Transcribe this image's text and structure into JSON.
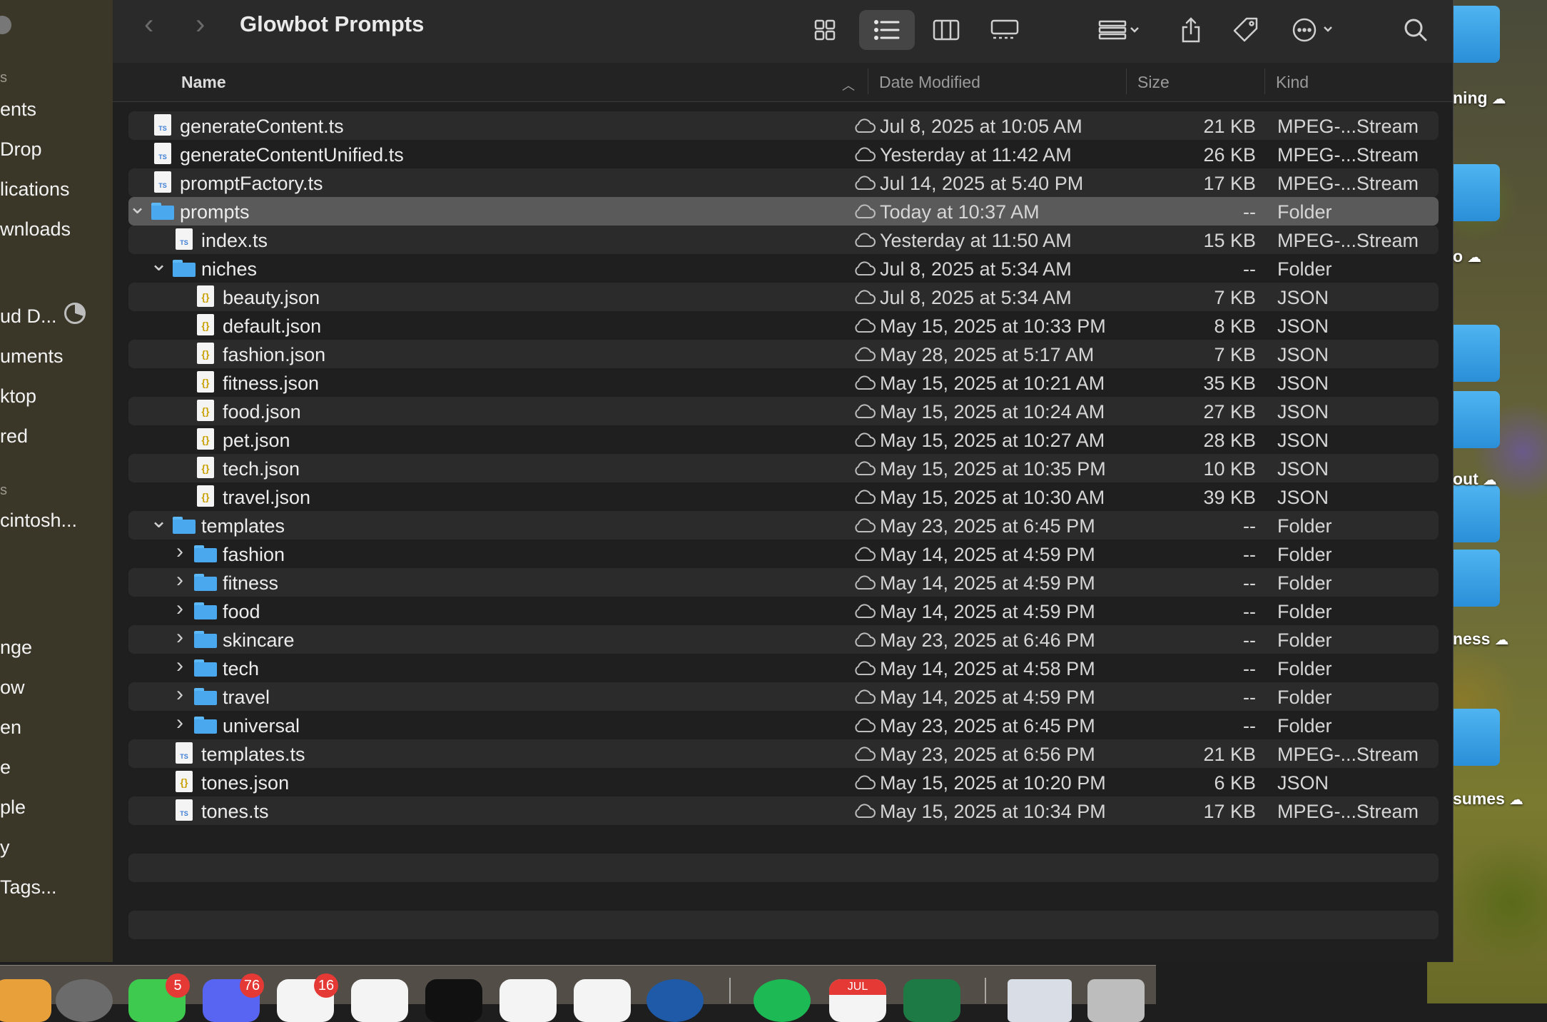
{
  "window": {
    "title": "Glowbot Prompts"
  },
  "columns": {
    "name": "Name",
    "date_modified": "Date Modified",
    "size": "Size",
    "kind": "Kind"
  },
  "sidebar": {
    "items": [
      "ents",
      "Drop",
      "lications",
      "wnloads",
      "ud D...",
      "uments",
      "ktop",
      "red",
      "cintosh...",
      "nge",
      "ow",
      "en",
      "e",
      "ple",
      "y",
      "Tags..."
    ],
    "headers": [
      "s",
      "s"
    ]
  },
  "rows": [
    {
      "name": "generateContent.ts",
      "date": "Jul 8, 2025 at 10:05 AM",
      "size": "21 KB",
      "kind": "MPEG-...Stream",
      "type": "ts",
      "depth": 0,
      "disclosure": ""
    },
    {
      "name": "generateContentUnified.ts",
      "date": "Yesterday at 11:42 AM",
      "size": "26 KB",
      "kind": "MPEG-...Stream",
      "type": "ts",
      "depth": 0,
      "disclosure": ""
    },
    {
      "name": "promptFactory.ts",
      "date": "Jul 14, 2025 at 5:40 PM",
      "size": "17 KB",
      "kind": "MPEG-...Stream",
      "type": "ts",
      "depth": 0,
      "disclosure": ""
    },
    {
      "name": "prompts",
      "date": "Today at 10:37 AM",
      "size": "--",
      "kind": "Folder",
      "type": "folder",
      "depth": 0,
      "disclosure": "open",
      "selected": true
    },
    {
      "name": "index.ts",
      "date": "Yesterday at 11:50 AM",
      "size": "15 KB",
      "kind": "MPEG-...Stream",
      "type": "ts",
      "depth": 1,
      "disclosure": ""
    },
    {
      "name": "niches",
      "date": "Jul 8, 2025 at 5:34 AM",
      "size": "--",
      "kind": "Folder",
      "type": "folder",
      "depth": 1,
      "disclosure": "open"
    },
    {
      "name": "beauty.json",
      "date": "Jul 8, 2025 at 5:34 AM",
      "size": "7 KB",
      "kind": "JSON",
      "type": "json",
      "depth": 2,
      "disclosure": ""
    },
    {
      "name": "default.json",
      "date": "May 15, 2025 at 10:33 PM",
      "size": "8 KB",
      "kind": "JSON",
      "type": "json",
      "depth": 2,
      "disclosure": ""
    },
    {
      "name": "fashion.json",
      "date": "May 28, 2025 at 5:17 AM",
      "size": "7 KB",
      "kind": "JSON",
      "type": "json",
      "depth": 2,
      "disclosure": ""
    },
    {
      "name": "fitness.json",
      "date": "May 15, 2025 at 10:21 AM",
      "size": "35 KB",
      "kind": "JSON",
      "type": "json",
      "depth": 2,
      "disclosure": ""
    },
    {
      "name": "food.json",
      "date": "May 15, 2025 at 10:24 AM",
      "size": "27 KB",
      "kind": "JSON",
      "type": "json",
      "depth": 2,
      "disclosure": ""
    },
    {
      "name": "pet.json",
      "date": "May 15, 2025 at 10:27 AM",
      "size": "28 KB",
      "kind": "JSON",
      "type": "json",
      "depth": 2,
      "disclosure": ""
    },
    {
      "name": "tech.json",
      "date": "May 15, 2025 at 10:35 PM",
      "size": "10 KB",
      "kind": "JSON",
      "type": "json",
      "depth": 2,
      "disclosure": ""
    },
    {
      "name": "travel.json",
      "date": "May 15, 2025 at 10:30 AM",
      "size": "39 KB",
      "kind": "JSON",
      "type": "json",
      "depth": 2,
      "disclosure": ""
    },
    {
      "name": "templates",
      "date": "May 23, 2025 at 6:45 PM",
      "size": "--",
      "kind": "Folder",
      "type": "folder",
      "depth": 1,
      "disclosure": "open"
    },
    {
      "name": "fashion",
      "date": "May 14, 2025 at 4:59 PM",
      "size": "--",
      "kind": "Folder",
      "type": "folder",
      "depth": 2,
      "disclosure": "closed"
    },
    {
      "name": "fitness",
      "date": "May 14, 2025 at 4:59 PM",
      "size": "--",
      "kind": "Folder",
      "type": "folder",
      "depth": 2,
      "disclosure": "closed"
    },
    {
      "name": "food",
      "date": "May 14, 2025 at 4:59 PM",
      "size": "--",
      "kind": "Folder",
      "type": "folder",
      "depth": 2,
      "disclosure": "closed"
    },
    {
      "name": "skincare",
      "date": "May 23, 2025 at 6:46 PM",
      "size": "--",
      "kind": "Folder",
      "type": "folder",
      "depth": 2,
      "disclosure": "closed"
    },
    {
      "name": "tech",
      "date": "May 14, 2025 at 4:58 PM",
      "size": "--",
      "kind": "Folder",
      "type": "folder",
      "depth": 2,
      "disclosure": "closed"
    },
    {
      "name": "travel",
      "date": "May 14, 2025 at 4:59 PM",
      "size": "--",
      "kind": "Folder",
      "type": "folder",
      "depth": 2,
      "disclosure": "closed"
    },
    {
      "name": "universal",
      "date": "May 23, 2025 at 6:45 PM",
      "size": "--",
      "kind": "Folder",
      "type": "folder",
      "depth": 2,
      "disclosure": "closed"
    },
    {
      "name": "templates.ts",
      "date": "May 23, 2025 at 6:56 PM",
      "size": "21 KB",
      "kind": "MPEG-...Stream",
      "type": "ts",
      "depth": 1,
      "disclosure": ""
    },
    {
      "name": "tones.json",
      "date": "May 15, 2025 at 10:20 PM",
      "size": "6 KB",
      "kind": "JSON",
      "type": "json",
      "depth": 1,
      "disclosure": ""
    },
    {
      "name": "tones.ts",
      "date": "May 15, 2025 at 10:34 PM",
      "size": "17 KB",
      "kind": "MPEG-...Stream",
      "type": "ts",
      "depth": 1,
      "disclosure": ""
    }
  ],
  "desktop_labels": [
    "ning",
    "o",
    "out",
    "ness",
    "sumes"
  ],
  "dock": {
    "badges": [
      "5",
      "76",
      "16"
    ],
    "calendar_month": "JUL"
  },
  "file_badges": {
    "ts": "TS",
    "json": "{}"
  },
  "colors": {
    "accent": "#4aa9ee",
    "selection": "#5a5a5a",
    "badge": "#e53935"
  }
}
